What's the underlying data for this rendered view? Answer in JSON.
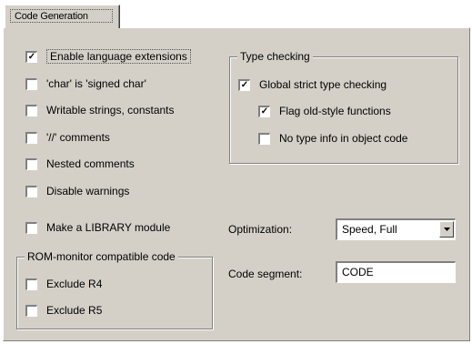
{
  "tab": {
    "label": "Code Generation"
  },
  "options": {
    "enable_lang_ext": {
      "label": "Enable language extensions",
      "checked": true
    },
    "char_signed": {
      "label": "'char' is 'signed char'",
      "checked": false
    },
    "writable_strings": {
      "label": "Writable strings, constants",
      "checked": false
    },
    "cpp_comments": {
      "label": "'//' comments",
      "checked": false
    },
    "nested_comments": {
      "label": "Nested comments",
      "checked": false
    },
    "disable_warnings": {
      "label": "Disable warnings",
      "checked": false
    },
    "library_module": {
      "label": "Make a LIBRARY module",
      "checked": false
    }
  },
  "rom_monitor": {
    "title": "ROM-monitor compatible code",
    "exclude_r4": {
      "label": "Exclude R4",
      "checked": false
    },
    "exclude_r5": {
      "label": "Exclude R5",
      "checked": false
    }
  },
  "type_checking": {
    "title": "Type checking",
    "global_strict": {
      "label": "Global strict type checking",
      "checked": true
    },
    "flag_old_style": {
      "label": "Flag old-style functions",
      "checked": true
    },
    "no_type_info": {
      "label": "No type info in object code",
      "checked": false
    }
  },
  "optimization": {
    "label": "Optimization:",
    "value": "Speed, Full"
  },
  "code_segment": {
    "label": "Code segment:",
    "value": "CODE"
  }
}
